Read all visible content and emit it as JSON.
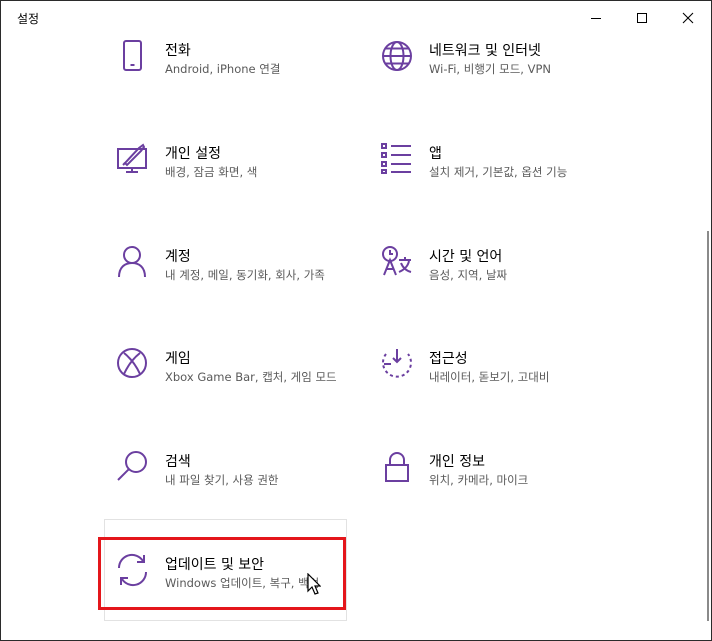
{
  "window": {
    "title": "설정",
    "controls": [
      "minimize-icon",
      "maximize-icon",
      "close-icon"
    ]
  },
  "tiles": [
    {
      "icon": "phone-icon",
      "name": "전화",
      "desc": "Android, iPhone 연결"
    },
    {
      "icon": "globe-icon",
      "name": "네트워크 및 인터넷",
      "desc": "Wi-Fi, 비행기 모드, VPN"
    },
    {
      "icon": "personalization-icon",
      "name": "개인 설정",
      "desc": "배경, 잠금 화면, 색"
    },
    {
      "icon": "apps-list-icon",
      "name": "앱",
      "desc": "설치 제거, 기본값, 옵션 기능"
    },
    {
      "icon": "person-icon",
      "name": "계정",
      "desc": "내 계정, 메일, 동기화, 회사, 가족"
    },
    {
      "icon": "language-icon",
      "name": "시간 및 언어",
      "desc": "음성, 지역, 날짜"
    },
    {
      "icon": "xbox-icon",
      "name": "게임",
      "desc": "Xbox Game Bar, 캡처, 게임 모드"
    },
    {
      "icon": "accessibility-icon",
      "name": "접근성",
      "desc": "내레이터, 돋보기, 고대비"
    },
    {
      "icon": "search-icon",
      "name": "검색",
      "desc": "내 파일 찾기, 사용 권한"
    },
    {
      "icon": "lock-icon",
      "name": "개인 정보",
      "desc": "위치, 카메라, 마이크"
    },
    {
      "icon": "sync-icon",
      "name": "업데이트 및 보안",
      "desc": "Windows 업데이트, 복구, 백업"
    }
  ],
  "colors": {
    "accent": "#6b3fa0",
    "highlight": "#e4161b",
    "text": "#000000",
    "secondary_text": "#5a5a5a"
  }
}
